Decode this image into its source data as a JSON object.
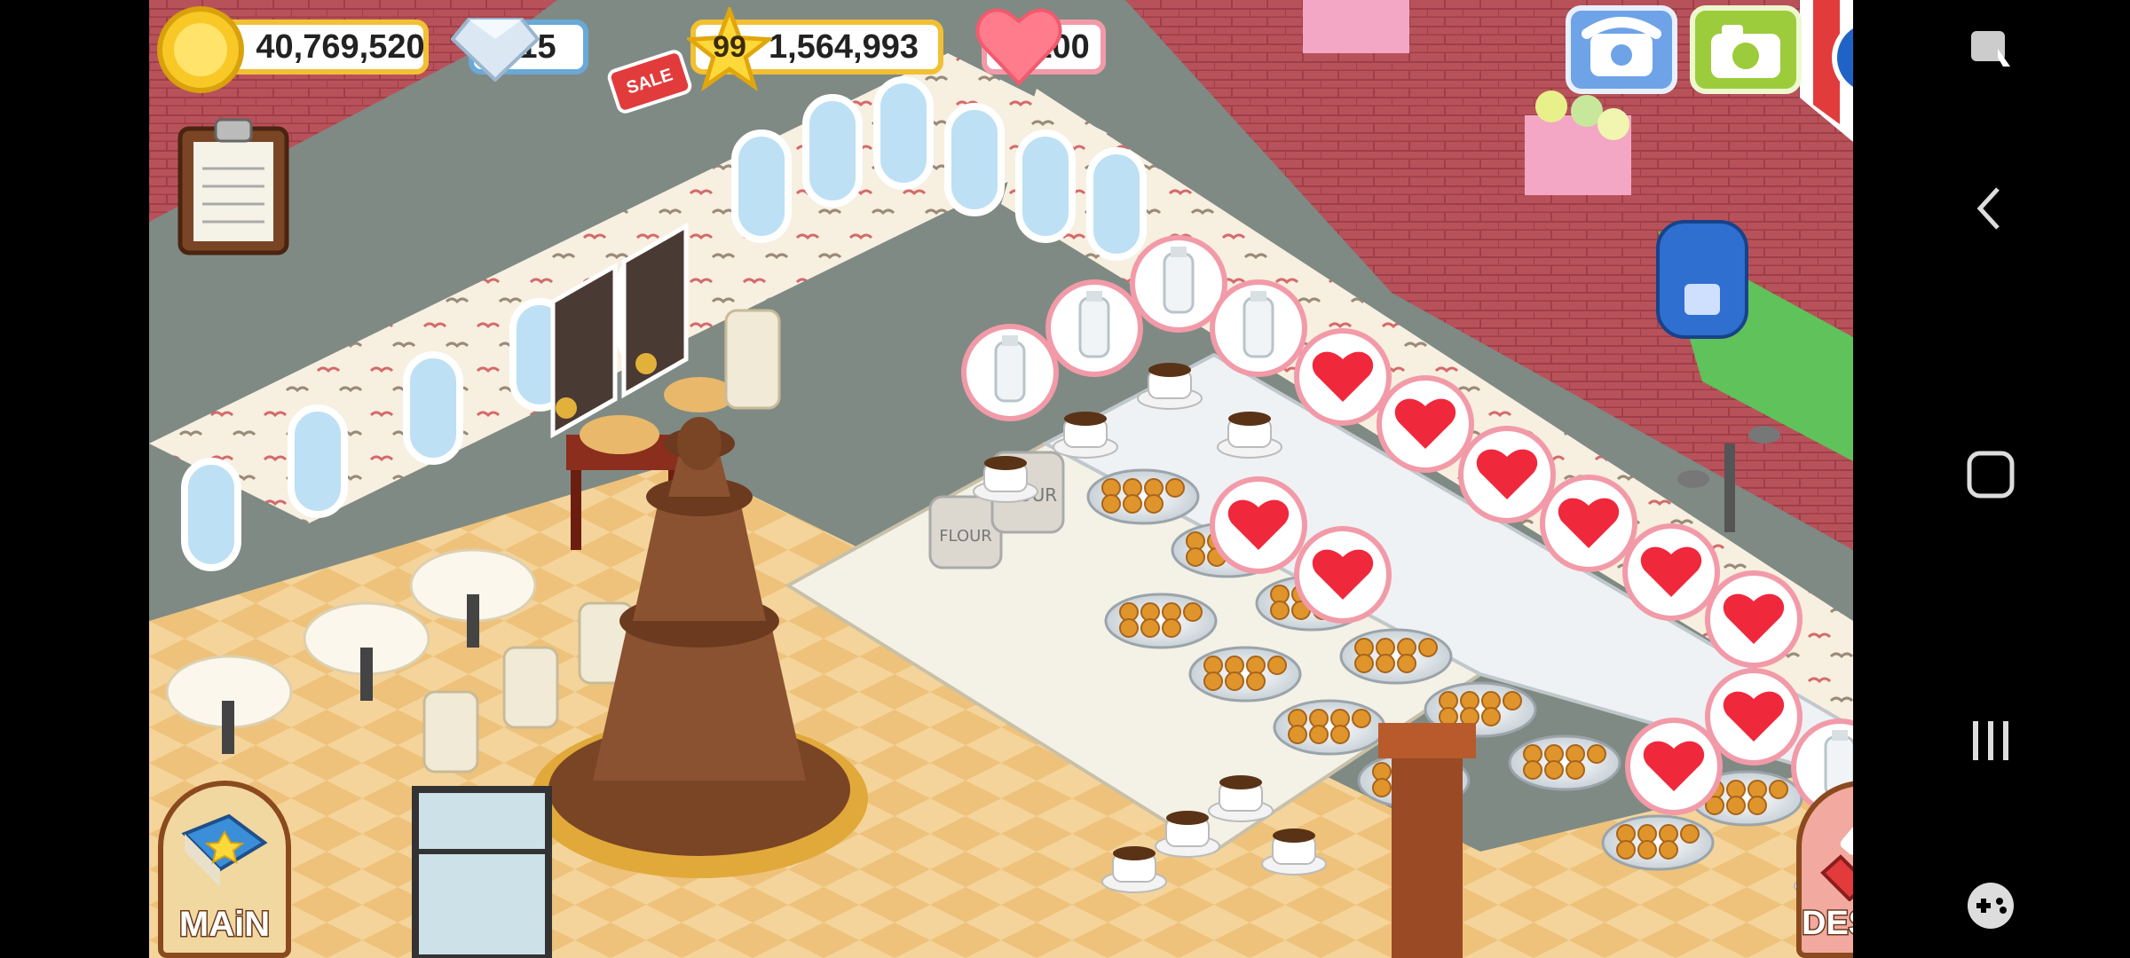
{
  "hud": {
    "coins": "40,769,520",
    "gems": "15",
    "sale_badge": "SALE",
    "level": "99",
    "experience": "1,564,993",
    "hearts": "100"
  },
  "buttons": {
    "main_label": "MAiN",
    "design_label": "DESiGN"
  },
  "scene_text": {
    "flour_sack": "FLOUR"
  },
  "icons": {
    "coin": "coin-icon",
    "gem": "diamond-icon",
    "star": "star-icon",
    "heart": "heart-icon",
    "clipboard": "clipboard-icon",
    "phone": "phone-icon",
    "camera": "camera-icon",
    "social": "social-icon",
    "main": "cookbook-icon",
    "design": "paintbrush-icon"
  },
  "colors": {
    "hud_border": "#f2c033",
    "gem_border": "#6aa8d8",
    "heart_border": "#f29aa8",
    "button_green": "#9ccc3c",
    "button_blue": "#5b8fd8"
  }
}
